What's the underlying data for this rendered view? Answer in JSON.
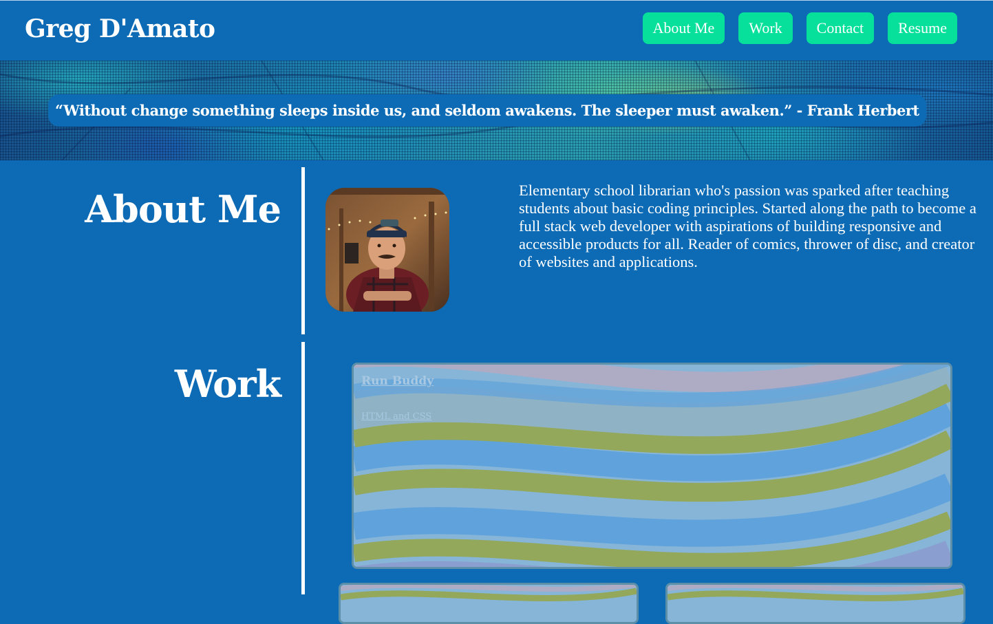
{
  "header": {
    "site_name": "Greg D'Amato",
    "nav": [
      {
        "label": "About Me"
      },
      {
        "label": "Work"
      },
      {
        "label": "Contact"
      },
      {
        "label": "Resume"
      }
    ]
  },
  "banner": {
    "quote": "“Without change something sleeps inside us, and seldom awakens. The sleeper must awaken.” - Frank Herbert"
  },
  "about": {
    "heading": "About Me",
    "bio": "Elementary school librarian who's passion was sparked after teaching students about basic coding principles. Started along the path to become a full stack web developer with aspirations of building responsive and accessible products for all. Reader of comics, thrower of disc, and creator of websites and applications."
  },
  "work": {
    "heading": "Work",
    "projects": [
      {
        "title": "Run Buddy",
        "tech": "HTML and CSS"
      }
    ]
  },
  "colors": {
    "page_background": "#0d6bb5",
    "nav_button": "#06e09a",
    "text": "#ffffff",
    "card_border": "#5e8fa9"
  }
}
